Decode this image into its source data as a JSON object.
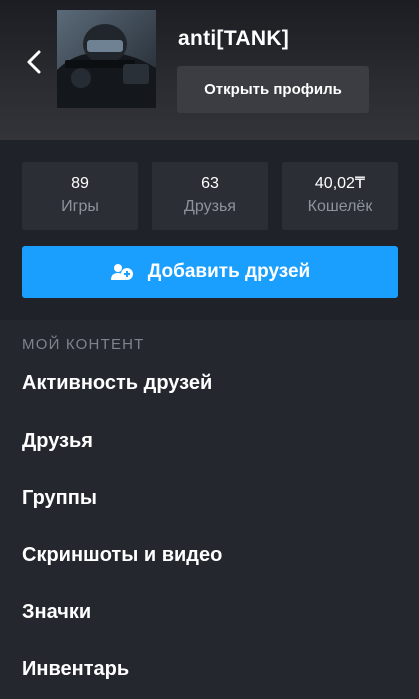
{
  "header": {
    "username": "anti[TANK]",
    "open_profile_label": "Открыть профиль"
  },
  "stats": [
    {
      "value": "89",
      "label": "Игры"
    },
    {
      "value": "63",
      "label": "Друзья"
    },
    {
      "value": "40,02₸",
      "label": "Кошелёк"
    }
  ],
  "add_friends_label": "Добавить друзей",
  "content": {
    "section_title": "МОЙ КОНТЕНТ",
    "items": [
      "Активность друзей",
      "Друзья",
      "Группы",
      "Скриншоты и видео",
      "Значки",
      "Инвентарь"
    ]
  },
  "colors": {
    "accent": "#1a9fff",
    "background": "#1d2026",
    "card": "#2b2e35",
    "muted_text": "#8d939b"
  },
  "icons": {
    "back": "chevron-left-icon",
    "add_friend": "add-user-icon"
  }
}
